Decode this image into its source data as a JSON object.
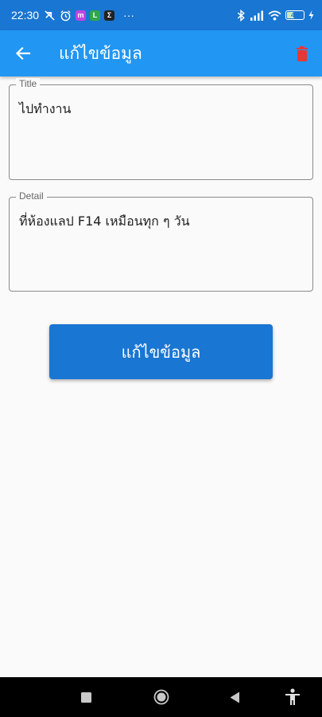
{
  "status_bar": {
    "time": "22:30",
    "more": "···",
    "battery": "43",
    "colors": {
      "messenger": "#c244e0",
      "line": "#2ea84a",
      "sigma": "#222222"
    }
  },
  "app_bar": {
    "title": "แก้ไขข้อมูล",
    "back_icon": "arrow-left-icon",
    "delete_icon": "trash-icon",
    "delete_color": "#e53935"
  },
  "form": {
    "title_label": "Title",
    "title_value": "ไปทำงาน",
    "detail_label": "Detail",
    "detail_value": "ที่ห้องแลป F14 เหมือนทุก ๆ วัน"
  },
  "submit_button": {
    "label": "แก้ไขข้อมูล",
    "color": "#1976d2"
  },
  "nav_bar": {
    "icons": [
      "recent-apps-icon",
      "home-icon",
      "back-triangle-icon",
      "accessibility-icon"
    ]
  }
}
